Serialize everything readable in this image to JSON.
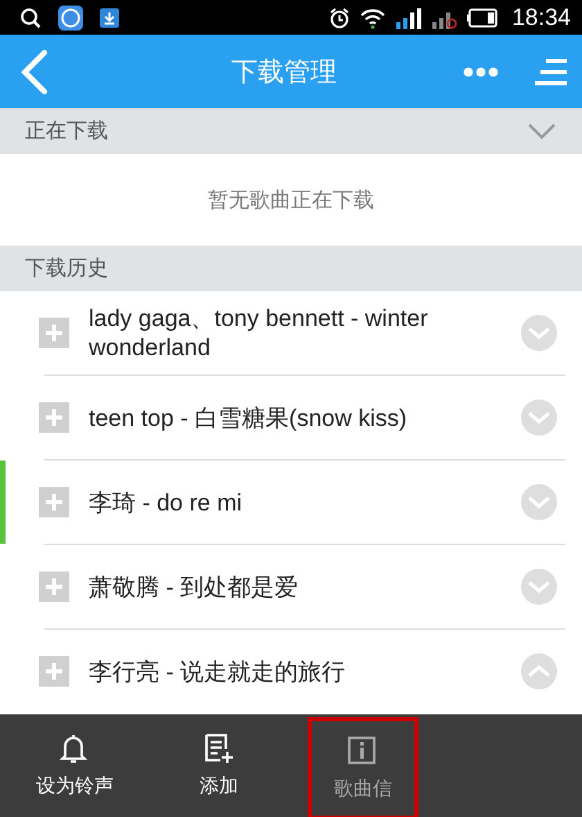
{
  "status_bar": {
    "time": "18:34"
  },
  "header": {
    "title": "下载管理"
  },
  "downloading": {
    "title": "正在下载",
    "expanded": false,
    "empty_text": "暂无歌曲正在下载"
  },
  "history": {
    "title": "下载历史",
    "items": [
      {
        "title": "lady gaga、tony bennett - winter wonderland",
        "playing": false,
        "expanded": false
      },
      {
        "title": "teen top - 白雪糖果(snow kiss)",
        "playing": false,
        "expanded": false
      },
      {
        "title": "李琦 - do re mi",
        "playing": true,
        "expanded": false
      },
      {
        "title": "萧敬腾 - 到处都是爱",
        "playing": false,
        "expanded": false
      },
      {
        "title": "李行亮 - 说走就走的旅行",
        "playing": false,
        "expanded": true
      }
    ]
  },
  "toolbar": [
    {
      "kind": "bell",
      "label": "设为铃声",
      "highlighted": false
    },
    {
      "kind": "add",
      "label": "添加",
      "highlighted": false
    },
    {
      "kind": "info",
      "label": "歌曲信",
      "highlighted": true
    }
  ]
}
